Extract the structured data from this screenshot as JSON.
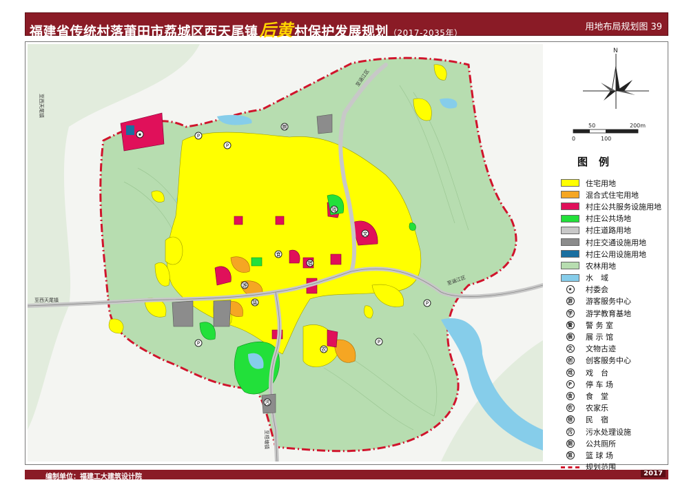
{
  "header": {
    "title_pre": "福建省传统村落莆田市荔城区西天尾镇",
    "title_accent": "后黄",
    "title_post": "村保护发展规划",
    "title_years": "（2017-2035年）",
    "plan_no": "用地布局规划图 39"
  },
  "map": {
    "road_labels": [
      "至西天尾镇",
      "至西天尾镇",
      "至涵江区",
      "至涵江区",
      "至梧塘镇"
    ],
    "colors": {
      "residential": "#ffff00",
      "mixed": "#f5a623",
      "public_service": "#e0105a",
      "public_space": "#22e03a",
      "road": "#c8c8c8",
      "transport": "#8c8c8c",
      "utility": "#1a6fa0",
      "farmland": "#b7ddb0",
      "water": "#86cdea",
      "boundary": "#d0142c"
    }
  },
  "compass": {
    "north": "N"
  },
  "scale": {
    "labels": [
      "50",
      "200m",
      "0",
      "100"
    ]
  },
  "legend": {
    "title": "图例",
    "area_items": [
      {
        "label": "住宅用地",
        "color": "#ffff00"
      },
      {
        "label": "混合式住宅用地",
        "color": "#f5a623"
      },
      {
        "label": "村庄公共服务设施用地",
        "color": "#e0105a"
      },
      {
        "label": "村庄公共场地",
        "color": "#22e03a"
      },
      {
        "label": "村庄道路用地",
        "color": "#c8c8c8"
      },
      {
        "label": "村庄交通设施用地",
        "color": "#8c8c8c"
      },
      {
        "label": "村庄公用设施用地",
        "color": "#1a6fa0"
      },
      {
        "label": "农林用地",
        "color": "#b7ddb0"
      },
      {
        "label": "水　域",
        "color": "#86cdea"
      }
    ],
    "symbol_items": [
      {
        "label": "村委会",
        "glyph": "★"
      },
      {
        "label": "游客服务中心",
        "glyph": "游"
      },
      {
        "label": "游学教育基地",
        "glyph": "学"
      },
      {
        "label": "警 务 室",
        "glyph": "警"
      },
      {
        "label": "展 示 馆",
        "glyph": "展"
      },
      {
        "label": "文物古迹",
        "glyph": "文"
      },
      {
        "label": "创客服务中心",
        "glyph": "创"
      },
      {
        "label": "戏　台",
        "glyph": "戏"
      },
      {
        "label": "停 车 场",
        "glyph": "P"
      },
      {
        "label": "食　堂",
        "glyph": "食"
      },
      {
        "label": "农家乐",
        "glyph": "农"
      },
      {
        "label": "民　宿",
        "glyph": "宿"
      },
      {
        "label": "污水处理设施",
        "glyph": "污"
      },
      {
        "label": "公共厕所",
        "glyph": "厕"
      },
      {
        "label": "篮 球 场",
        "glyph": "篮"
      }
    ],
    "boundary_label": "规划范围"
  },
  "footer": {
    "left": "编制单位：福建工大建筑设计院",
    "year": "2017"
  }
}
